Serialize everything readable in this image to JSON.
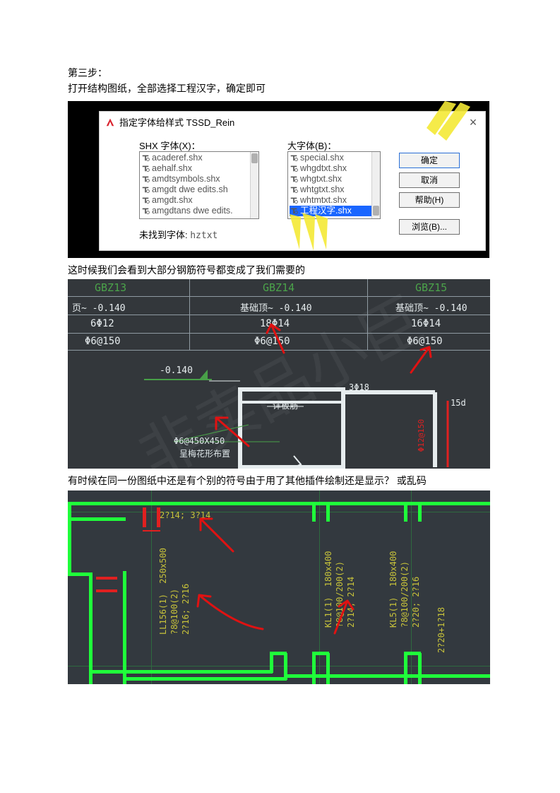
{
  "intro": {
    "step_label": "第三步：",
    "instruction": "打开结构图纸，全部选择工程汉字，确定即可"
  },
  "dialog": {
    "title": "指定字体给样式 TSSD_Rein",
    "shx_label": "SHX 字体(X)：",
    "big_label": "大字体(B)：",
    "shx_list": [
      "acaderef.shx",
      "aehalf.shx",
      "amdtsymbols.shx",
      "amgdt dwe edits.sh",
      "amgdt.shx",
      "amgdtans dwe edits."
    ],
    "big_list": [
      "special.shx",
      "whgdtxt.shx",
      "whgtxt.shx",
      "whtgtxt.shx",
      "whtmtxt.shx",
      "工程汉字.shx"
    ],
    "big_selected_index": 5,
    "buttons": {
      "ok": "确定",
      "cancel": "取消",
      "help": "帮助(H)",
      "browse": "浏览(B)..."
    },
    "not_found_label": "未找到字体: ",
    "not_found_value": "hztxt"
  },
  "caption_after_dialog": "这时候我们会看到大部分钢筋符号都变成了我们需要的",
  "cad_table": {
    "headers": [
      "GBZ13",
      "GBZ14",
      "GBZ15"
    ],
    "row1": [
      "页~ -0.140",
      "基础顶~ -0.140",
      "基础顶~ -0.140"
    ],
    "row2": [
      "6Φ12",
      "18Φ14",
      "16Φ14"
    ],
    "row3": [
      "Φ6@150",
      "Φ6@150",
      "Φ6@150"
    ],
    "dim_label": "-0.140",
    "detail_label": "详板筋",
    "stirrup_label1": "Φ6@450X450",
    "stirrup_label2": "呈梅花形布置",
    "corner_label": "3Φ18",
    "right_label": "15d",
    "right_vtext": "Φ12@150"
  },
  "caption_after_table": "有时候在同一份图纸中还是有个别的符号由于用了其他插件绘制还是显示？ 或乱码",
  "cad_plan": {
    "top_label": "2?14; 3?14",
    "beam1": {
      "name": "LL156(1)  250x500",
      "bar1": "?8@100(2)",
      "bar2": "2?16; 2?16"
    },
    "beam2": {
      "name": "KL1(1)  180x400",
      "bar1": "?8@100/200(2)",
      "bar2": "2?14; 2?14"
    },
    "beam3": {
      "name": "KL5(1)  180x400",
      "bar1": "?8@100/200(2)",
      "bar2": "2?20; 2?16"
    },
    "right_label": "2?20+1?18"
  }
}
